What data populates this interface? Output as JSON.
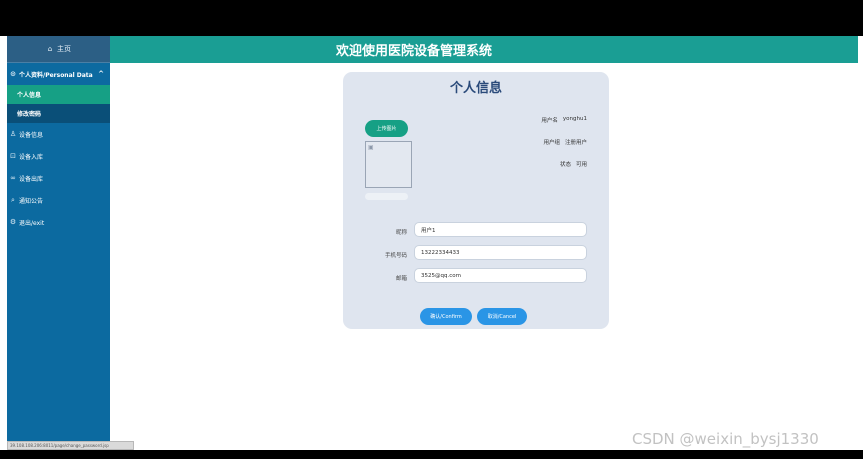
{
  "header": {
    "title": "欢迎使用医院设备管理系统"
  },
  "sidebar": {
    "home": "主页",
    "home_icon": "home-icon",
    "group": {
      "label": "个人资料/Personal Data",
      "icon": "user-circle-icon",
      "chevron": "^",
      "items": [
        {
          "label": "个人信息",
          "state": "active"
        },
        {
          "label": "修改密码",
          "state": "hover"
        }
      ]
    },
    "items": [
      {
        "label": "设备信息",
        "icon": "person-icon",
        "glyph": "♙"
      },
      {
        "label": "设备入库",
        "icon": "box-icon",
        "glyph": "⊡"
      },
      {
        "label": "设备出库",
        "icon": "link-icon",
        "glyph": "∞"
      },
      {
        "label": "通知公告",
        "icon": "search-icon",
        "glyph": "⌕"
      },
      {
        "label": "退出/exit",
        "icon": "gear-icon",
        "glyph": "⚙"
      }
    ]
  },
  "profile": {
    "title": "个人信息",
    "upload_label": "上传图片",
    "info": [
      {
        "label": "用户名",
        "value": "yonghu1"
      },
      {
        "label": "用户组",
        "value": "注册用户"
      },
      {
        "label": "状态",
        "value": "可用"
      }
    ],
    "fields": [
      {
        "label": "昵称",
        "value": "用户1"
      },
      {
        "label": "手机号码",
        "value": "13222334433"
      },
      {
        "label": "邮箱",
        "value": "3525@qq.com"
      }
    ],
    "confirm_label": "确认/Confirm",
    "cancel_label": "取消/Cancel"
  },
  "status_url": "39.108.108.206:8011/page/change_password.jsp",
  "watermark": "CSDN @weixin_bysj1330",
  "colors": {
    "sidebar": "#0c6aa0",
    "header": "#1a9e94",
    "active": "#16a085",
    "button": "#2a95e6"
  }
}
